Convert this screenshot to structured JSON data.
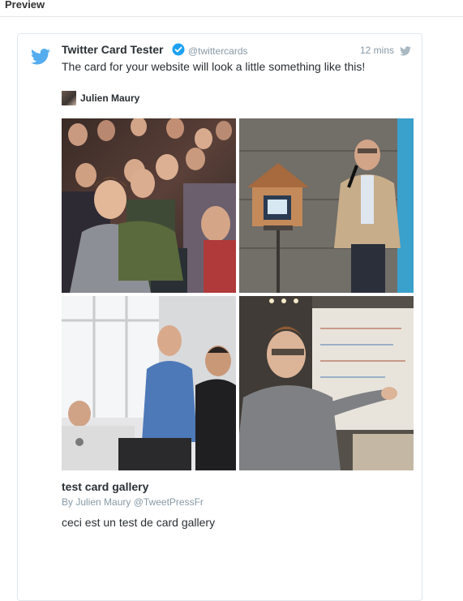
{
  "preview": {
    "title": "Preview"
  },
  "tweet": {
    "author_name": "Twitter Card Tester",
    "author_handle": "@twittercards",
    "timestamp": "12 mins",
    "text": "The card for your website will look a little something like this!",
    "icons": {
      "brand": "twitter-bird-icon",
      "verified": "verified-badge-icon",
      "source": "twitter-bird-small-icon"
    },
    "colors": {
      "brand_blue": "#55acee",
      "verified_blue": "#1da1f2",
      "muted_gray": "#8899a6",
      "text_dark": "#292f33"
    }
  },
  "card": {
    "attribution_name": "Julien Maury",
    "gallery_photos": [
      "conference-audience-photo",
      "speaker-with-birdhouse-photo",
      "people-working-at-computers-photo",
      "presenter-gesturing-photo"
    ],
    "title": "test card gallery",
    "byline": "By Julien Maury @TweetPressFr",
    "description": "ceci est un test de card gallery"
  }
}
